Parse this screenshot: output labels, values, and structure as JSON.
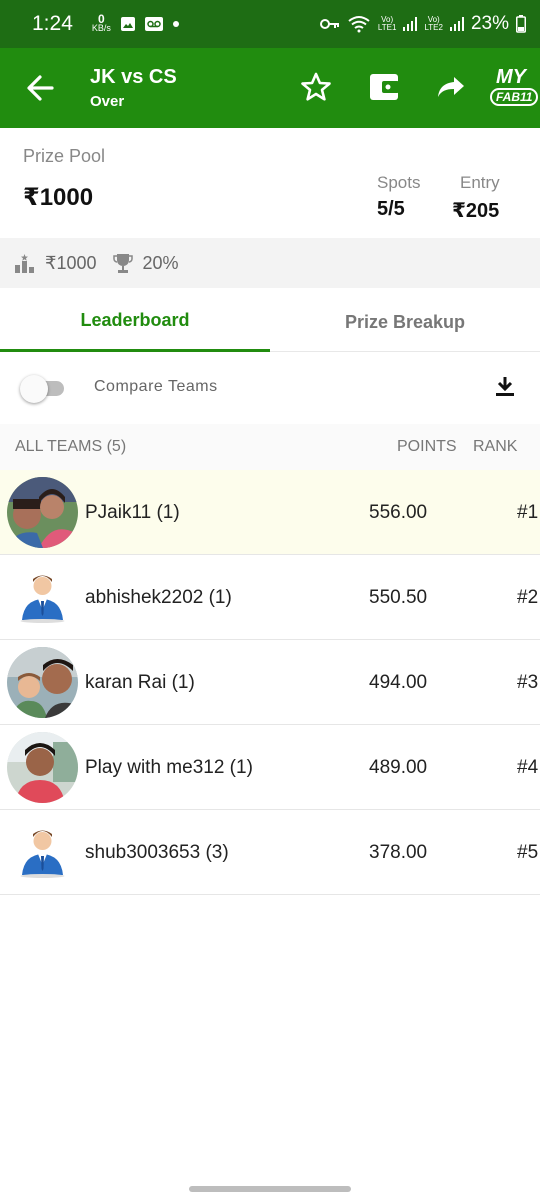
{
  "status_bar": {
    "time": "1:24",
    "net_speed_value": "0",
    "net_speed_unit": "KB/s",
    "sim1_label": "LTE1",
    "sim2_label": "LTE2",
    "battery": "23%"
  },
  "app_bar": {
    "title": "JK vs CS",
    "subtitle": "Over",
    "logo_line1": "MY",
    "logo_line2": "FAB11"
  },
  "contest": {
    "prize_pool_label": "Prize Pool",
    "prize_pool_value": "₹1000",
    "spots_label": "Spots",
    "spots_value": "5/5",
    "entry_label": "Entry",
    "entry_value": "₹205"
  },
  "info_strip": {
    "first_prize": "₹1000",
    "winners_percent": "20%"
  },
  "tabs": [
    {
      "label": "Leaderboard",
      "active": true
    },
    {
      "label": "Prize Breakup",
      "active": false
    }
  ],
  "compare": {
    "label": "Compare Teams",
    "enabled": false
  },
  "list_header": {
    "all_teams": "ALL TEAMS (5)",
    "points": "POINTS",
    "rank": "RANK"
  },
  "teams": [
    {
      "name": "PJaik11 (1)",
      "points": "556.00",
      "rank": "#1",
      "avatar": "photo-couple"
    },
    {
      "name": "abhishek2202 (1)",
      "points": "550.50",
      "rank": "#2",
      "avatar": "default-user-icon"
    },
    {
      "name": "karan Rai  (1)",
      "points": "494.00",
      "rank": "#3",
      "avatar": "photo-man-child"
    },
    {
      "name": "Play with me312 (1)",
      "points": "489.00",
      "rank": "#4",
      "avatar": "photo-man"
    },
    {
      "name": "shub3003653 (3)",
      "points": "378.00",
      "rank": "#5",
      "avatar": "default-user-icon"
    }
  ],
  "colors": {
    "status_bar": "#1e6d14",
    "app_bar": "#218c0f",
    "accent": "#218c0f",
    "highlight_row": "#fdfdec"
  }
}
